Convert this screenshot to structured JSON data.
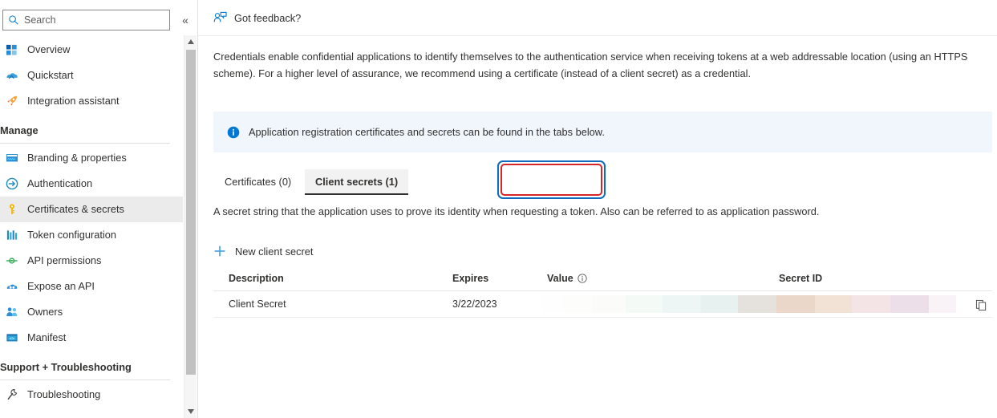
{
  "sidebar": {
    "search": {
      "placeholder": "Search",
      "value": ""
    },
    "collapse_label": "«",
    "items": [
      {
        "label": "Overview",
        "icon": "overview-icon",
        "type": "item",
        "selected": false
      },
      {
        "label": "Quickstart",
        "icon": "quickstart-icon",
        "type": "item",
        "selected": false
      },
      {
        "label": "Integration assistant",
        "icon": "rocket-icon",
        "type": "item",
        "selected": false
      },
      {
        "label": "Manage",
        "icon": "",
        "type": "group",
        "selected": false
      },
      {
        "label": "Branding & properties",
        "icon": "branding-icon",
        "type": "item",
        "selected": false
      },
      {
        "label": "Authentication",
        "icon": "authentication-icon",
        "type": "item",
        "selected": false
      },
      {
        "label": "Certificates & secrets",
        "icon": "key-icon",
        "type": "item",
        "selected": true
      },
      {
        "label": "Token configuration",
        "icon": "token-icon",
        "type": "item",
        "selected": false
      },
      {
        "label": "API permissions",
        "icon": "api-permissions-icon",
        "type": "item",
        "selected": false
      },
      {
        "label": "Expose an API",
        "icon": "expose-api-icon",
        "type": "item",
        "selected": false
      },
      {
        "label": "Owners",
        "icon": "owners-icon",
        "type": "item",
        "selected": false
      },
      {
        "label": "Manifest",
        "icon": "manifest-icon",
        "type": "item",
        "selected": false
      },
      {
        "label": "Support + Troubleshooting",
        "icon": "",
        "type": "group",
        "selected": false
      },
      {
        "label": "Troubleshooting",
        "icon": "wrench-icon",
        "type": "item",
        "selected": false
      }
    ]
  },
  "command_bar": {
    "feedback_label": "Got feedback?"
  },
  "main": {
    "intro": "Credentials enable confidential applications to identify themselves to the authentication service when receiving tokens at a web addressable location (using an HTTPS scheme). For a higher level of assurance, we recommend using a certificate (instead of a client secret) as a credential.",
    "info_banner": "Application registration certificates and secrets can be found in the tabs below.",
    "tabs": [
      {
        "label": "Certificates (0)",
        "selected": false
      },
      {
        "label": "Client secrets (1)",
        "selected": true
      }
    ],
    "tab_description": "A secret string that the application uses to prove its identity when requesting a token. Also can be referred to as application password.",
    "new_secret_label": "New client secret",
    "table": {
      "columns": [
        "Description",
        "Expires",
        "Value",
        "Secret ID"
      ],
      "rows": [
        {
          "description": "Client Secret",
          "expires": "3/22/2023",
          "value": "",
          "secret_id": ""
        }
      ]
    }
  },
  "colors": {
    "accent": "#0078d4",
    "highlight_outer": "#0f6cbd",
    "highlight_inner": "#d62728",
    "info_background": "#f0f6fc",
    "selected_row": "#ebebeb"
  }
}
